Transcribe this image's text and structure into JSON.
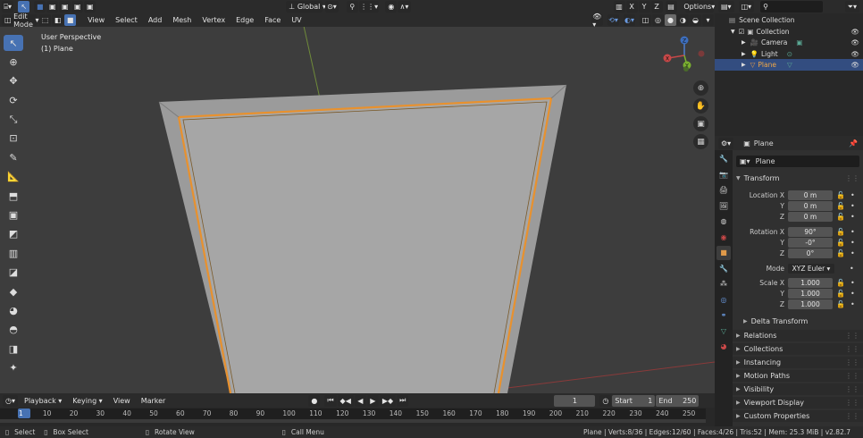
{
  "header": {
    "mode": "Edit Mode",
    "menus": [
      "View",
      "Select",
      "Add",
      "Mesh",
      "Vertex",
      "Edge",
      "Face",
      "UV"
    ],
    "transform_orientation": "Global",
    "axes": [
      "X",
      "Y",
      "Z"
    ],
    "options_label": "Options"
  },
  "viewport": {
    "perspective_label": "User Perspective",
    "object_label": "(1) Plane",
    "gizmo_axes": {
      "x": "X",
      "y": "Y",
      "z": "Z"
    }
  },
  "outliner": {
    "root": "Scene Collection",
    "collection": "Collection",
    "items": [
      {
        "name": "Camera",
        "selected": false
      },
      {
        "name": "Light",
        "selected": false
      },
      {
        "name": "Plane",
        "selected": true
      }
    ]
  },
  "properties": {
    "header_name": "Plane",
    "object_name": "Plane",
    "transform_label": "Transform",
    "location": {
      "label": "Location X",
      "x": "0 m",
      "y": "0 m",
      "z": "0 m"
    },
    "rotation": {
      "label": "Rotation X",
      "x": "90°",
      "y": "-0°",
      "z": "0°"
    },
    "mode_label": "Mode",
    "mode_value": "XYZ Euler",
    "scale": {
      "label": "Scale X",
      "x": "1.000",
      "y": "1.000",
      "z": "1.000"
    },
    "axis_y": "Y",
    "axis_z": "Z",
    "delta_transform": "Delta Transform",
    "panels": [
      "Relations",
      "Collections",
      "Instancing",
      "Motion Paths",
      "Visibility",
      "Viewport Display",
      "Custom Properties"
    ]
  },
  "timeline": {
    "menus": [
      "Playback",
      "Keying",
      "View",
      "Marker"
    ],
    "current_frame": "1",
    "start_label": "Start",
    "start_value": "1",
    "end_label": "End",
    "end_value": "250",
    "ruler_ticks": [
      "1",
      "10",
      "20",
      "30",
      "40",
      "50",
      "60",
      "70",
      "80",
      "90",
      "100",
      "110",
      "120",
      "130",
      "140",
      "150",
      "160",
      "170",
      "180",
      "190",
      "200",
      "210",
      "220",
      "230",
      "240",
      "250"
    ]
  },
  "statusbar": {
    "select": "Select",
    "box_select": "Box Select",
    "rotate_view": "Rotate View",
    "call_menu": "Call Menu",
    "stats": "Plane | Verts:8/36 | Edges:12/60 | Faces:4/26 | Tris:52 | Mem: 25.3 MiB | v2.82.7"
  },
  "colors": {
    "accent": "#4772b3",
    "selection_edge": "#e8912e",
    "viewport_bg": "#3d3d3d",
    "mesh_face": "#a2a2a2"
  }
}
